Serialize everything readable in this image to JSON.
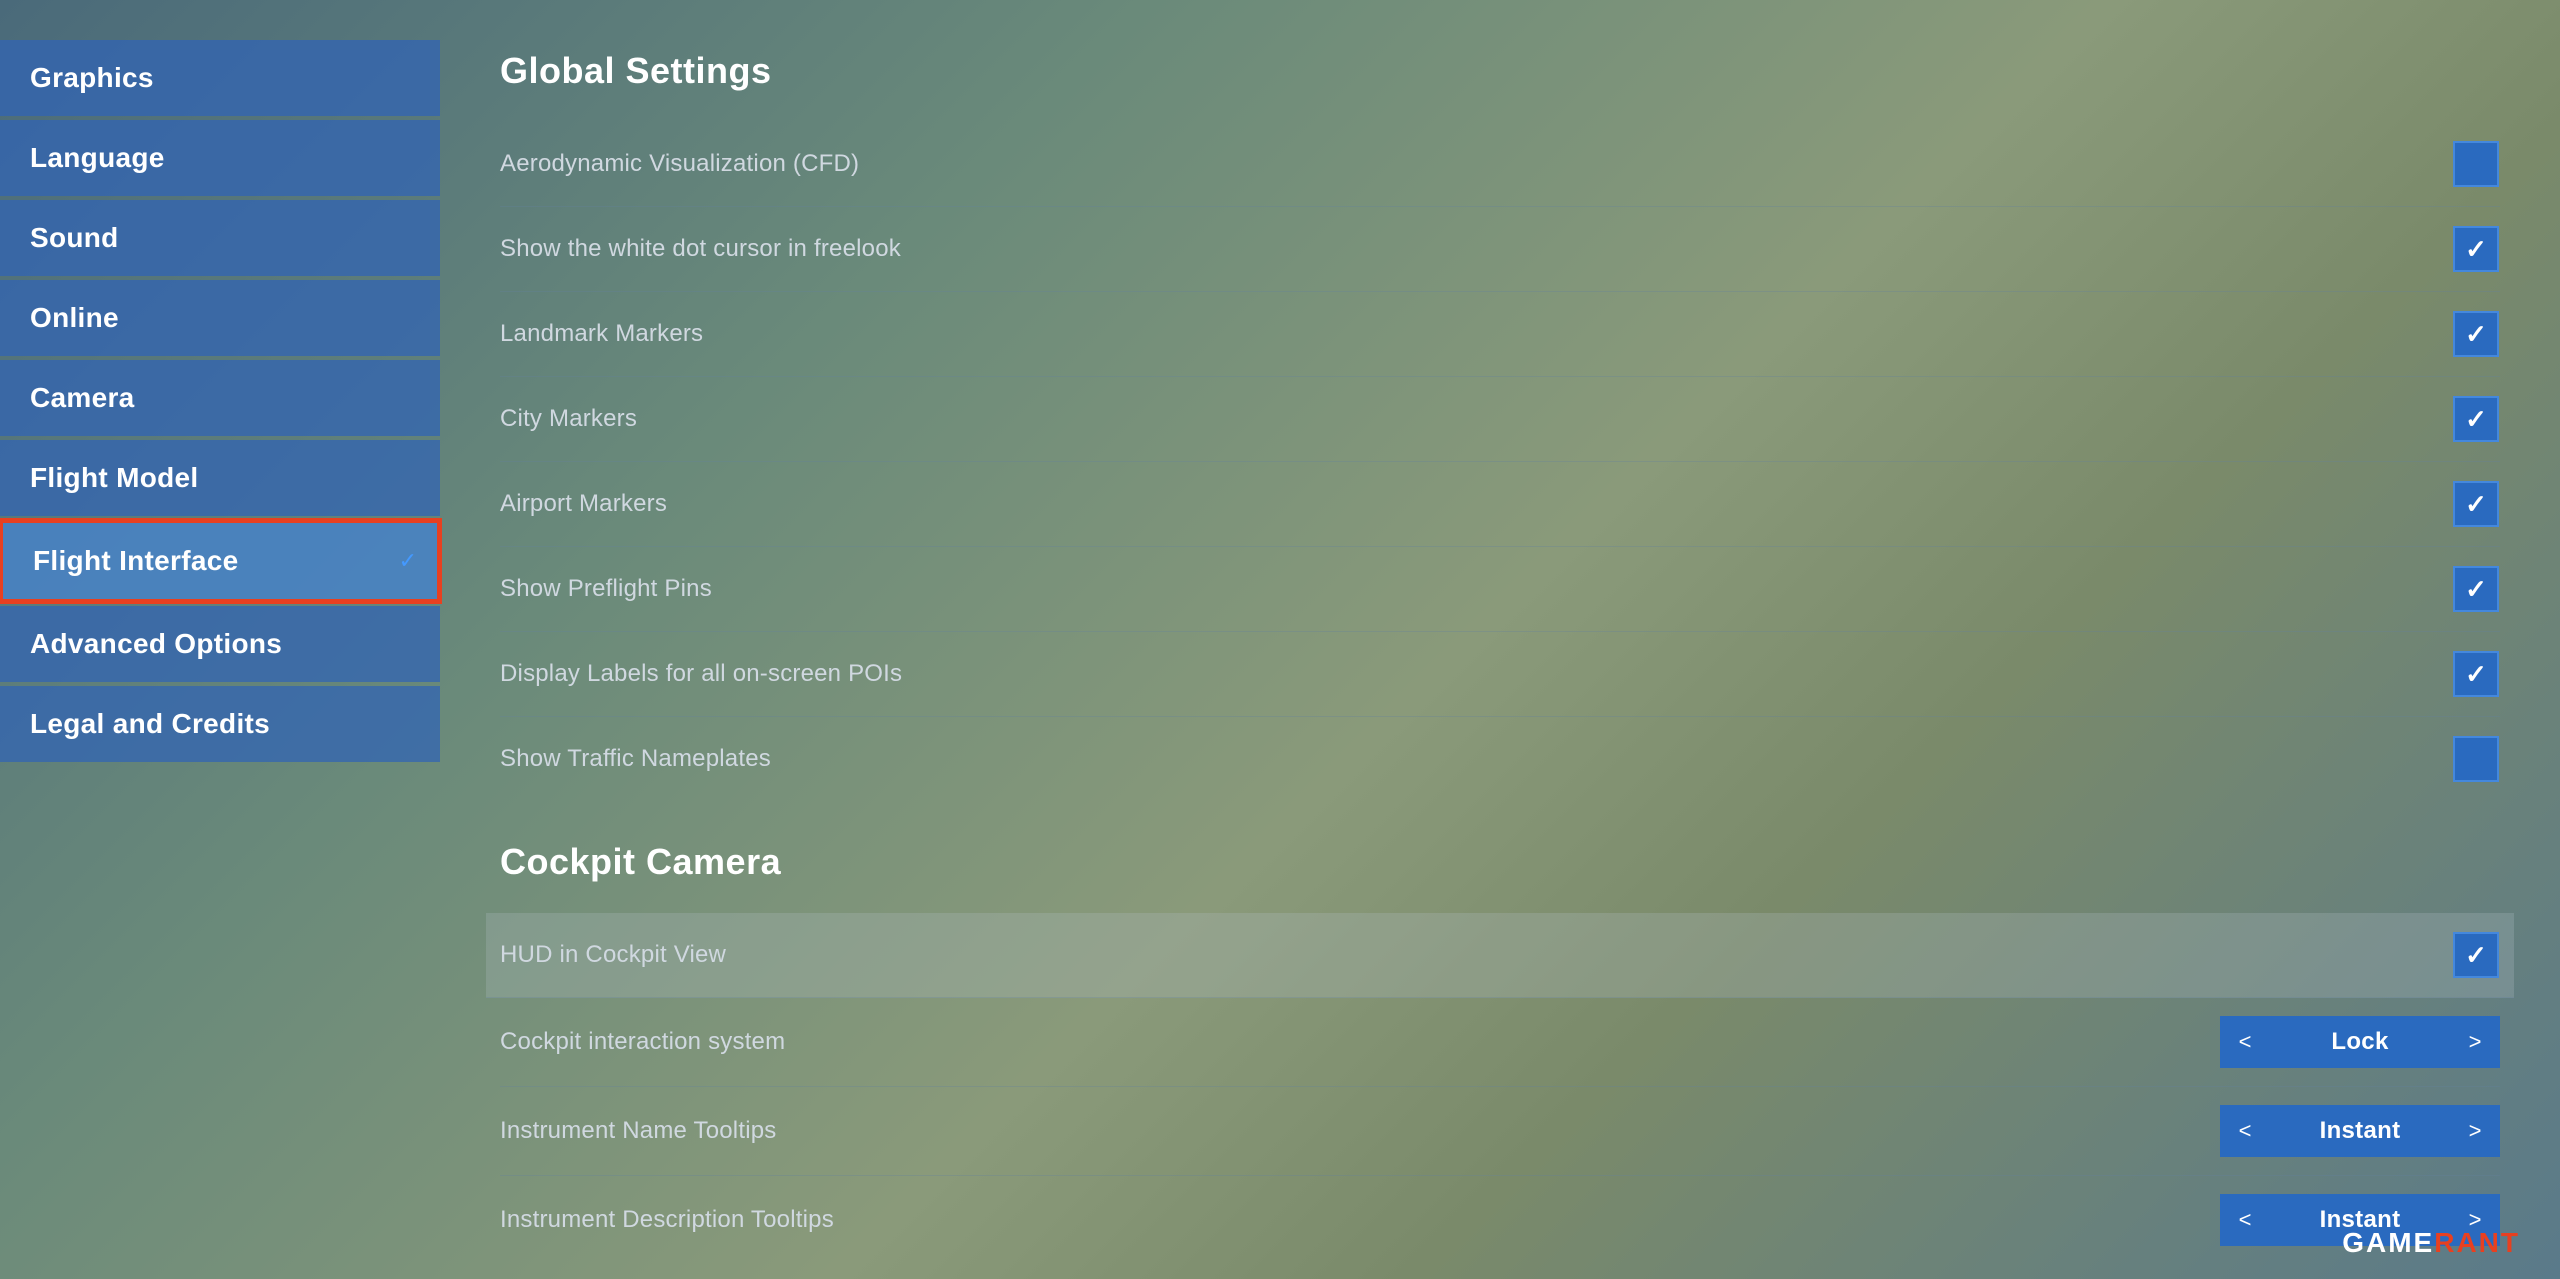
{
  "sidebar": {
    "items": [
      {
        "id": "graphics",
        "label": "Graphics",
        "active": false,
        "hasCheck": false
      },
      {
        "id": "language",
        "label": "Language",
        "active": false,
        "hasCheck": false
      },
      {
        "id": "sound",
        "label": "Sound",
        "active": false,
        "hasCheck": false
      },
      {
        "id": "online",
        "label": "Online",
        "active": false,
        "hasCheck": false
      },
      {
        "id": "camera",
        "label": "Camera",
        "active": false,
        "hasCheck": false
      },
      {
        "id": "flight-model",
        "label": "Flight Model",
        "active": false,
        "hasCheck": false
      },
      {
        "id": "flight-interface",
        "label": "Flight Interface",
        "active": true,
        "hasCheck": true
      },
      {
        "id": "advanced-options",
        "label": "Advanced Options",
        "active": false,
        "hasCheck": false
      },
      {
        "id": "legal-credits",
        "label": "Legal and Credits",
        "active": false,
        "hasCheck": false
      }
    ]
  },
  "global_settings": {
    "title": "Global Settings",
    "rows": [
      {
        "id": "aerodynamic-viz",
        "label": "Aerodynamic Visualization (CFD)",
        "type": "checkbox",
        "checked": false,
        "blue_only": true
      },
      {
        "id": "white-dot-cursor",
        "label": "Show the white dot cursor in freelook",
        "type": "checkbox",
        "checked": true
      },
      {
        "id": "landmark-markers",
        "label": "Landmark Markers",
        "type": "checkbox",
        "checked": true
      },
      {
        "id": "city-markers",
        "label": "City Markers",
        "type": "checkbox",
        "checked": true
      },
      {
        "id": "airport-markers",
        "label": "Airport Markers",
        "type": "checkbox",
        "checked": true
      },
      {
        "id": "preflight-pins",
        "label": "Show Preflight Pins",
        "type": "checkbox",
        "checked": true
      },
      {
        "id": "display-labels",
        "label": "Display Labels for all on-screen POIs",
        "type": "checkbox",
        "checked": true
      },
      {
        "id": "traffic-nameplates",
        "label": "Show Traffic Nameplates",
        "type": "checkbox",
        "checked": false,
        "blue_only": true
      }
    ]
  },
  "cockpit_camera": {
    "title": "Cockpit Camera",
    "rows": [
      {
        "id": "hud-cockpit",
        "label": "HUD in Cockpit View",
        "type": "checkbox",
        "checked": true,
        "highlighted": true
      },
      {
        "id": "cockpit-interaction",
        "label": "Cockpit interaction system",
        "type": "selector",
        "value": "Lock"
      },
      {
        "id": "instrument-tooltips",
        "label": "Instrument Name Tooltips",
        "type": "selector",
        "value": "Instant"
      },
      {
        "id": "instrument-desc",
        "label": "Instrument Description Tooltips",
        "type": "selector",
        "value": "Instant"
      }
    ]
  },
  "watermark": {
    "game": "GAME",
    "rant": "RANT"
  }
}
